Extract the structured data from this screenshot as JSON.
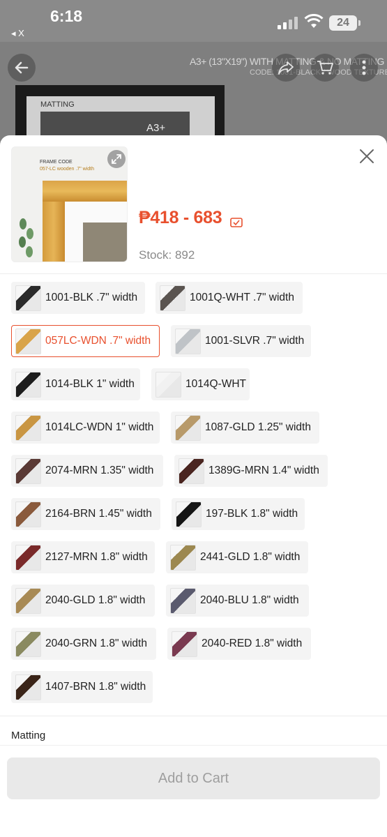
{
  "status_bar": {
    "time": "6:18",
    "back_app": "◂ X",
    "battery": "24"
  },
  "background": {
    "title": "A3+ (13\"X19\") WITH MATTING & NO MATTING",
    "code": "CODE: 1001-BLACK / WOOD TEXTURE",
    "mat_label": "MATTING",
    "size_label": "A3+"
  },
  "product": {
    "frame_code_label": "FRAME CODE",
    "frame_code_value": "057-LC wooden .7\" width",
    "price": "₱418 - 683",
    "stock": "Stock: 892"
  },
  "variants": [
    {
      "label": "1001-BLK .7\" width",
      "swatch": "#2a2a2a",
      "selected": false
    },
    {
      "label": "1001Q-WHT .7\" width",
      "swatch": "#5a5450",
      "selected": false
    },
    {
      "label": "057LC-WDN .7\" width",
      "swatch": "#d9a44a",
      "selected": true
    },
    {
      "label": "1001-SLVR .7\" width",
      "swatch": "#bfc3c7",
      "selected": false
    },
    {
      "label": "1014-BLK 1\" width",
      "swatch": "#1d1d1d",
      "selected": false
    },
    {
      "label": "1014Q-WHT",
      "swatch": "#f1f1f1",
      "selected": false
    },
    {
      "label": "1014LC-WDN 1\" width",
      "swatch": "#c99643",
      "selected": false
    },
    {
      "label": "1087-GLD 1.25\" width",
      "swatch": "#b89a6a",
      "selected": false
    },
    {
      "label": "2074-MRN 1.35\" width",
      "swatch": "#5a3a35",
      "selected": false
    },
    {
      "label": "1389G-MRN 1.4\" width",
      "swatch": "#4a2520",
      "selected": false
    },
    {
      "label": "2164-BRN 1.45\" width",
      "swatch": "#8a5a3c",
      "selected": false
    },
    {
      "label": "197-BLK 1.8\" width",
      "swatch": "#151515",
      "selected": false
    },
    {
      "label": "2127-MRN 1.8\" width",
      "swatch": "#7a2a2a",
      "selected": false
    },
    {
      "label": "2441-GLD 1.8\" width",
      "swatch": "#9c8850",
      "selected": false
    },
    {
      "label": "2040-GLD 1.8\" width",
      "swatch": "#a88a55",
      "selected": false
    },
    {
      "label": "2040-BLU 1.8\" width",
      "swatch": "#5a5a6e",
      "selected": false
    },
    {
      "label": "2040-GRN 1.8\" width",
      "swatch": "#8a8a60",
      "selected": false
    },
    {
      "label": "2040-RED 1.8\" width",
      "swatch": "#7a3a50",
      "selected": false
    },
    {
      "label": "1407-BRN 1.8\" width",
      "swatch": "#3a2418",
      "selected": false
    }
  ],
  "section": {
    "matting_label": "Matting"
  },
  "footer": {
    "add_to_cart": "Add to Cart"
  },
  "colors": {
    "accent": "#e8502e",
    "muted": "#8a8a8a",
    "chip_bg": "#f4f4f4"
  }
}
